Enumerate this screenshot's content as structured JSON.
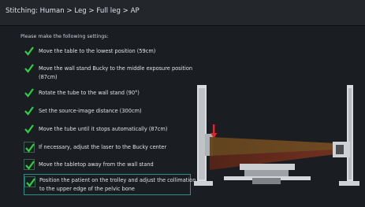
{
  "window": {
    "title": "Stitching: Human > Leg > Full leg > AP"
  },
  "instructions": {
    "prompt": "Please make the following settings:",
    "steps": [
      {
        "label": "Move the table to the lowest position (59cm)",
        "checked": true,
        "style": "plain"
      },
      {
        "label": "Move the wall stand Bucky to the middle exposure position (87cm)",
        "checked": true,
        "style": "plain"
      },
      {
        "label": "Rotate the tube to the wall stand (90°)",
        "checked": true,
        "style": "plain"
      },
      {
        "label": "Set the source-image distance (300cm)",
        "checked": true,
        "style": "plain"
      },
      {
        "label": "Move the tube until it stops automatically (87cm)",
        "checked": true,
        "style": "plain"
      },
      {
        "label": "If necessary, adjust the laser to the Bucky center",
        "checked": true,
        "style": "boxed"
      },
      {
        "label": "Move the tabletop away from the wall stand",
        "checked": true,
        "style": "boxed"
      },
      {
        "label": "Position the patient on the trolley and adjust the collimation to the upper edge of the pelvic bone",
        "checked": true,
        "style": "boxed",
        "active": true
      }
    ]
  },
  "illustration": {
    "subject": "xray-room-setup",
    "colors": {
      "beam": "#6b2a1a",
      "beam_highlight": "#8a7a2a",
      "marker": "#e0262a",
      "equipment": "#d9dcdf"
    }
  },
  "theme": {
    "background": "#1a1d21",
    "titlebar": "#23272c",
    "check_color": "#2fcf45",
    "active_border": "#2f8e8a"
  }
}
